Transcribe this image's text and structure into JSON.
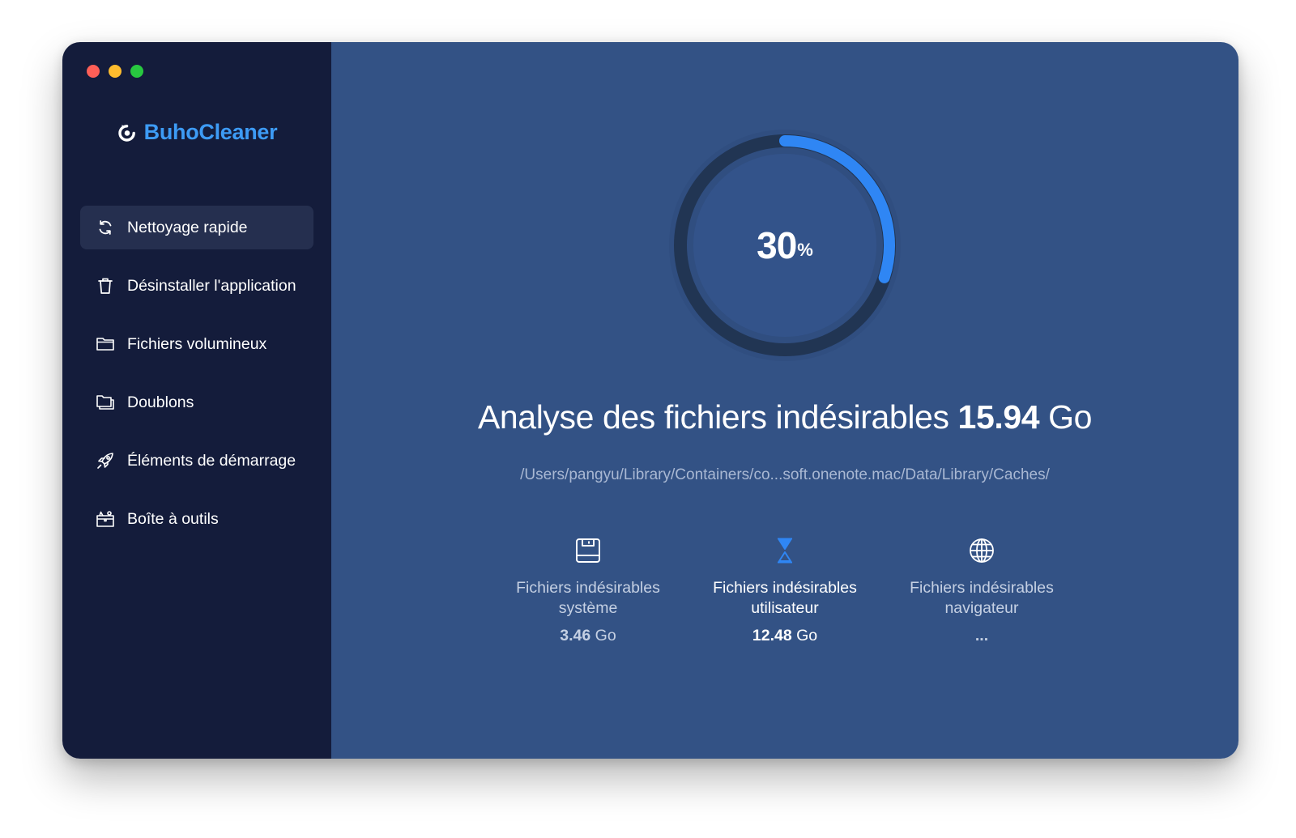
{
  "window": {
    "traffic_lights": [
      {
        "name": "close",
        "color": "#fe5f57"
      },
      {
        "name": "minimize",
        "color": "#febc2e"
      },
      {
        "name": "zoom",
        "color": "#28c840"
      }
    ]
  },
  "brand": {
    "name": "BuhoCleaner",
    "logo_icon": "owl-logo-icon",
    "color": "#3d9bf5"
  },
  "sidebar": {
    "items": [
      {
        "label": "Nettoyage rapide",
        "icon": "refresh-icon",
        "active": true
      },
      {
        "label": "Désinstaller l'application",
        "icon": "trash-icon",
        "active": false
      },
      {
        "label": "Fichiers volumineux",
        "icon": "folder-icon",
        "active": false
      },
      {
        "label": "Doublons",
        "icon": "duplicate-folder-icon",
        "active": false
      },
      {
        "label": "Éléments de démarrage",
        "icon": "rocket-icon",
        "active": false
      },
      {
        "label": "Boîte à outils",
        "icon": "toolbox-icon",
        "active": false
      }
    ]
  },
  "scan": {
    "progress_value": "30",
    "progress_unit": "%",
    "progress_fraction": 0.3,
    "headline_text": "Analyse des fichiers indésirables",
    "headline_size": "15.94",
    "headline_unit": "Go",
    "current_path": "/Users/pangyu/Library/Containers/co...soft.onenote.mac/Data/Library/Caches/"
  },
  "categories": [
    {
      "icon": "disk-icon",
      "label_line1": "Fichiers indésirables",
      "label_line2": "système",
      "size_value": "3.46",
      "size_unit": "Go",
      "active": false
    },
    {
      "icon": "hourglass-icon",
      "label_line1": "Fichiers indésirables",
      "label_line2": "utilisateur",
      "size_value": "12.48",
      "size_unit": "Go",
      "active": true
    },
    {
      "icon": "globe-icon",
      "label_line1": "Fichiers indésirables",
      "label_line2": "navigateur",
      "size_value": "...",
      "size_unit": "",
      "active": false
    }
  ],
  "colors": {
    "sidebar_bg": "#141c3b",
    "sidebar_active_bg": "#252f4f",
    "main_bg": "#335285",
    "accent": "#2f86f4",
    "ring_track": "#213553"
  }
}
